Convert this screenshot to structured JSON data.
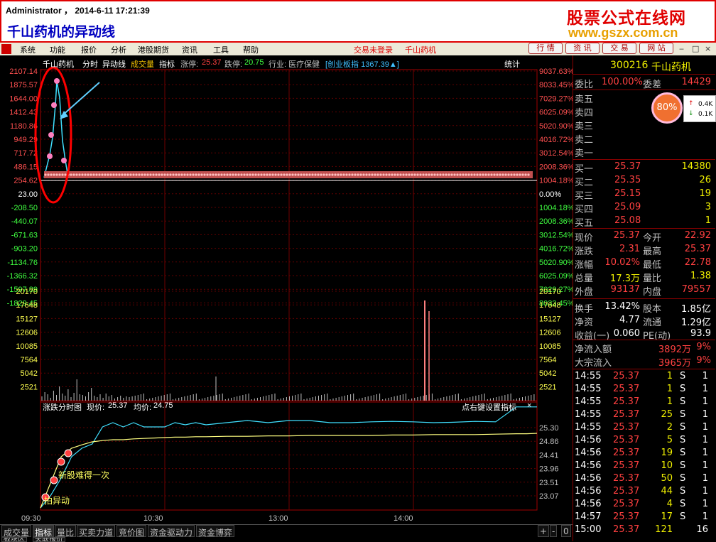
{
  "header": {
    "user_line": "Administrator  ，  2014-6-11 17:21:39",
    "title": "千山药机的异动线",
    "logo": "股票公式在线网",
    "url": "www.gszx.com.cn"
  },
  "menu": {
    "items": [
      "系统",
      "功能",
      "报价",
      "分析",
      "港股期货",
      "资讯",
      "工具",
      "帮助"
    ],
    "status": "交易未登录",
    "stock": "千山药机",
    "right_buttons": [
      "行 情",
      "资 讯",
      "交 易",
      "网 站"
    ]
  },
  "chart_title": {
    "name": "千山药机",
    "mode": "分时",
    "line": "异动线",
    "vol": "成交量",
    "ind": "指标",
    "up_label": "涨停:",
    "up_val": "25.37",
    "dn_label": "跌停:",
    "dn_val": "20.75",
    "ind_label": "行业:",
    "ind_val": "医疗保健",
    "board": "[创业板指 1367.39▲]",
    "stat": "统计"
  },
  "left_axis": [
    "2107.14",
    "1875.57",
    "1644.00",
    "1412.43",
    "1180.86",
    "949.29",
    "717.72",
    "486.15",
    "254.62",
    "23.00",
    "-208.50",
    "-440.07",
    "-671.63",
    "-903.20",
    "-1134.76",
    "-1366.32",
    "-1597.89",
    "-1829.45"
  ],
  "right_axis": [
    "9037.63%",
    "8033.45%",
    "7029.27%",
    "6025.09%",
    "5020.90%",
    "4016.72%",
    "3012.54%",
    "2008.36%",
    "1004.18%",
    "0.00%",
    "1004.18%",
    "2008.36%",
    "3012.54%",
    "4016.72%",
    "5020.90%",
    "6025.09%",
    "7029.27%",
    "8033.45%"
  ],
  "vol_axis": [
    "20170",
    "17648",
    "15127",
    "12606",
    "10085",
    "7564",
    "5042",
    "2521"
  ],
  "lower": {
    "title": "涨跌分时图",
    "price_label": "现价:",
    "price": "25.37",
    "avg_label": "均价:",
    "avg": "24.75",
    "hint": "点右键设置指标",
    "close": "×",
    "axis": [
      "25.30",
      "24.86",
      "24.41",
      "23.96",
      "23.51",
      "23.07"
    ],
    "ann1": "新股难得一次",
    "ann2": "拍异动"
  },
  "times": [
    "09:30",
    "10:30",
    "13:00",
    "14:00"
  ],
  "chart_data": {
    "type": "line",
    "title": "涨跌分时图",
    "price_x": [
      0,
      5,
      10,
      15,
      20,
      25,
      30,
      35,
      40,
      45,
      50,
      55,
      60,
      65,
      70,
      75,
      80,
      90,
      100,
      110,
      120,
      130,
      140,
      150,
      160,
      170,
      180,
      190,
      200,
      210,
      220,
      230,
      235,
      240
    ],
    "price": [
      23.0,
      23.3,
      23.7,
      24.2,
      24.4,
      24.5,
      24.9,
      25.0,
      24.9,
      25.0,
      24.9,
      24.9,
      24.9,
      25.0,
      24.95,
      25.0,
      24.95,
      25.0,
      25.05,
      25.0,
      25.05,
      25.05,
      25.0,
      25.0,
      25.02,
      25.03,
      25.02,
      25.0,
      25.01,
      25.03,
      25.02,
      25.37,
      25.37,
      25.37
    ],
    "avg": [
      23.0,
      23.6,
      24.2,
      24.4,
      24.48,
      24.55,
      24.58,
      24.6,
      24.6,
      24.62,
      24.63,
      24.64,
      24.65,
      24.66,
      24.66,
      24.67,
      24.67,
      24.68,
      24.68,
      24.69,
      24.69,
      24.7,
      24.7,
      24.7,
      24.7,
      24.71,
      24.71,
      24.72,
      24.72,
      24.72,
      24.73,
      24.74,
      24.74,
      24.75
    ],
    "volume_spike": {
      "time": "14:10",
      "value": 17648
    }
  },
  "quote": {
    "code": "300216",
    "name": "千山药机",
    "wb_label": "委比",
    "wb": "100.00%",
    "wc_label": "委差",
    "wc": "14429",
    "sells": [
      "卖五",
      "卖四",
      "卖三",
      "卖二",
      "卖一"
    ],
    "buys": [
      {
        "l": "买一",
        "p": "25.37",
        "v": "14380"
      },
      {
        "l": "买二",
        "p": "25.35",
        "v": "26"
      },
      {
        "l": "买三",
        "p": "25.15",
        "v": "19"
      },
      {
        "l": "买四",
        "p": "25.09",
        "v": "3"
      },
      {
        "l": "买五",
        "p": "25.08",
        "v": "1"
      }
    ],
    "stats": [
      {
        "a": "现价",
        "b": "25.37",
        "c": "今开",
        "d": "22.92"
      },
      {
        "a": "涨跌",
        "b": "2.31",
        "c": "最高",
        "d": "25.37"
      },
      {
        "a": "涨幅",
        "b": "10.02%",
        "c": "最低",
        "d": "22.78"
      },
      {
        "a": "总量",
        "b": "17.3万",
        "c": "量比",
        "d": "1.38"
      },
      {
        "a": "外盘",
        "b": "93137",
        "c": "内盘",
        "d": "79557"
      },
      {
        "a": "换手",
        "b": "13.42%",
        "c": "股本",
        "d": "1.85亿"
      },
      {
        "a": "净资",
        "b": "4.77",
        "c": "流通",
        "d": "1.29亿"
      },
      {
        "a": "收益(一)",
        "b": "0.060",
        "c": "PE(动)",
        "d": "93.9"
      }
    ],
    "flow": [
      {
        "a": "净流入额",
        "b": "3892万",
        "c": "9%"
      },
      {
        "a": "大宗流入",
        "b": "3965万",
        "c": "9%"
      }
    ],
    "ticks": [
      {
        "t": "14:55",
        "p": "25.37",
        "v": "1",
        "s": "S",
        "n": "1"
      },
      {
        "t": "14:55",
        "p": "25.37",
        "v": "1",
        "s": "S",
        "n": "1"
      },
      {
        "t": "14:55",
        "p": "25.37",
        "v": "1",
        "s": "S",
        "n": "1"
      },
      {
        "t": "14:55",
        "p": "25.37",
        "v": "25",
        "s": "S",
        "n": "1"
      },
      {
        "t": "14:55",
        "p": "25.37",
        "v": "2",
        "s": "S",
        "n": "1"
      },
      {
        "t": "14:56",
        "p": "25.37",
        "v": "5",
        "s": "S",
        "n": "1"
      },
      {
        "t": "14:56",
        "p": "25.37",
        "v": "19",
        "s": "S",
        "n": "1"
      },
      {
        "t": "14:56",
        "p": "25.37",
        "v": "10",
        "s": "S",
        "n": "1"
      },
      {
        "t": "14:56",
        "p": "25.37",
        "v": "50",
        "s": "S",
        "n": "1"
      },
      {
        "t": "14:56",
        "p": "25.37",
        "v": "44",
        "s": "S",
        "n": "1"
      },
      {
        "t": "14:56",
        "p": "25.37",
        "v": "4",
        "s": "S",
        "n": "1"
      },
      {
        "t": "14:57",
        "p": "25.37",
        "v": "17",
        "s": "S",
        "n": "1"
      },
      {
        "t": "15:00",
        "p": "25.37",
        "v": "121",
        "s": "",
        "n": "16"
      }
    ]
  },
  "tabs": [
    "成交量",
    "指标",
    "量比",
    "买卖力道",
    "竞价图",
    "资金驱动力",
    "资金博弈"
  ],
  "bottom_tabs": [
    "板块区",
    "关联报价"
  ],
  "ctrl": [
    "+",
    "-",
    "0"
  ],
  "badge": "80%",
  "float_panel": {
    "up": "0.4K",
    "down": "0.1K"
  }
}
